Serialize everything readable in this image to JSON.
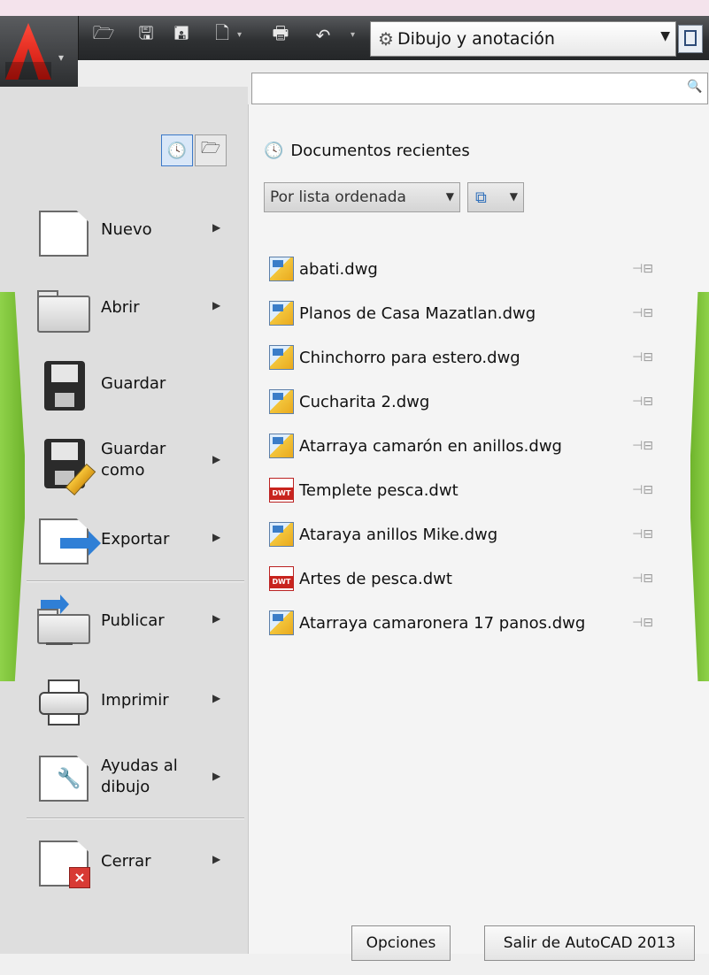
{
  "toolbar": {
    "workspace_label": "Dibujo y anotación"
  },
  "search": {
    "placeholder": ""
  },
  "menu": {
    "items": [
      {
        "label": "Nuevo"
      },
      {
        "label": "Abrir"
      },
      {
        "label": "Guardar"
      },
      {
        "label": "Guardar como"
      },
      {
        "label": "Exportar"
      },
      {
        "label": "Publicar"
      },
      {
        "label": "Imprimir"
      },
      {
        "label": "Ayudas al dibujo"
      },
      {
        "label": "Cerrar"
      }
    ]
  },
  "recent": {
    "header": "Documentos recientes",
    "sort_label": "Por lista ordenada",
    "files": [
      {
        "name": "abati.dwg",
        "type": "dwg"
      },
      {
        "name": "Planos de Casa Mazatlan.dwg",
        "type": "dwg"
      },
      {
        "name": "Chinchorro para estero.dwg",
        "type": "dwg"
      },
      {
        "name": "Cucharita 2.dwg",
        "type": "dwg"
      },
      {
        "name": "Atarraya camarón en anillos.dwg",
        "type": "dwg"
      },
      {
        "name": "Templete pesca.dwt",
        "type": "dwt"
      },
      {
        "name": "Ataraya anillos Mike.dwg",
        "type": "dwg"
      },
      {
        "name": "Artes de pesca.dwt",
        "type": "dwt"
      },
      {
        "name": "Atarraya camaronera 17 panos.dwg",
        "type": "dwg"
      }
    ]
  },
  "footer": {
    "options_label": "Opciones",
    "exit_label": "Salir de AutoCAD 2013"
  },
  "colors": {
    "accent_green": "#7cc23a",
    "app_red": "#d8241a",
    "panel_left": "#dedede",
    "panel_right": "#f4f4f4"
  }
}
